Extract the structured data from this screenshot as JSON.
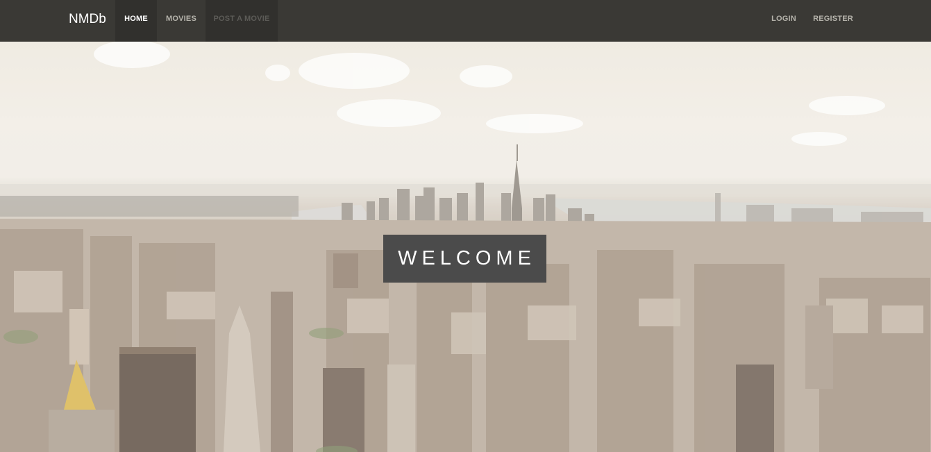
{
  "navbar": {
    "brand": "NMDb",
    "items": [
      {
        "label": "HOME",
        "state": "active"
      },
      {
        "label": "MOVIES",
        "state": "normal"
      },
      {
        "label": "POST A MOVIE",
        "state": "disabled"
      }
    ],
    "right_items": [
      {
        "label": "LOGIN"
      },
      {
        "label": "REGISTER"
      }
    ]
  },
  "hero": {
    "background": "aerial city skyline photo (washed out)",
    "welcome_text": "WELCOME"
  },
  "colors": {
    "navbar_bg": "#3a3935",
    "active_nav_bg": "#31302d",
    "welcome_box_bg": "#4b4b4b",
    "nav_text": "#b5b3ab"
  }
}
